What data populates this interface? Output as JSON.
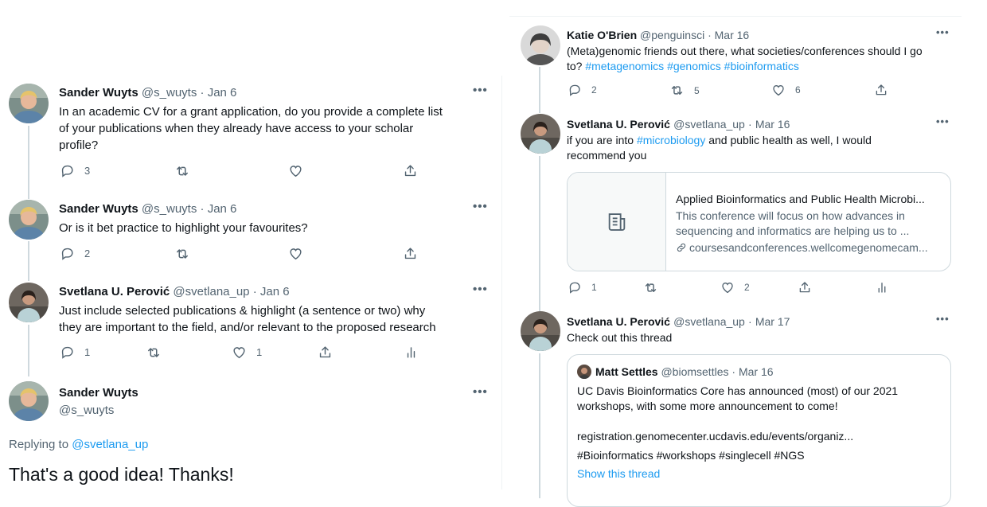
{
  "left": {
    "tweets": [
      {
        "name": "Sander Wuyts",
        "handle": "@s_wuyts",
        "sep": "·",
        "date": "Jan 6",
        "lines": [
          "In an academic CV for a grant application, do you provide a complete list",
          "of your publications when they already have access to your scholar",
          "profile?"
        ],
        "reply_count": "3"
      },
      {
        "name": "Sander Wuyts",
        "handle": "@s_wuyts",
        "sep": "·",
        "date": "Jan 6",
        "lines": [
          "Or is it bet practice to highlight your favourites?"
        ],
        "reply_count": "2"
      },
      {
        "name": "Svetlana U. Perović",
        "handle": "@svetlana_up",
        "sep": "·",
        "date": "Jan 6",
        "lines": [
          "Just include selected publications & highlight (a sentence or two) why",
          "they are important to the field, and/or relevant to the proposed research"
        ],
        "reply_count": "1",
        "like_count": "1"
      }
    ],
    "focused": {
      "name": "Sander Wuyts",
      "handle": "@s_wuyts",
      "replying_prefix": "Replying to",
      "replying_to": "@svetlana_up",
      "text": "That's a good idea! Thanks!"
    }
  },
  "right": {
    "tweet1": {
      "name": "Katie O'Brien",
      "handle": "@penguinsci",
      "sep": "·",
      "date": "Mar 16",
      "line1": "(Meta)genomic friends out there, what societies/conferences should I go",
      "line2_prefix": "to?",
      "hashtags": [
        "#metagenomics",
        "#genomics",
        "#bioinformatics"
      ],
      "reply_count": "2",
      "retweet_count": "5",
      "like_count": "6"
    },
    "tweet2": {
      "name": "Svetlana U. Perović",
      "handle": "@svetlana_up",
      "sep": "·",
      "date": "Mar 16",
      "line1_prefix": "if you are into",
      "line1_link": "#microbiology",
      "line1_suffix": "and public health as well, I would",
      "line2": "recommend you",
      "card": {
        "title": "Applied Bioinformatics and Public Health Microbi...",
        "desc1": "This conference will focus on how advances in",
        "desc2": "sequencing and informatics are helping us to ...",
        "url": "coursesandconferences.wellcomegenomecam..."
      },
      "reply_count": "1",
      "like_count": "2"
    },
    "tweet3": {
      "name": "Svetlana U. Perović",
      "handle": "@svetlana_up",
      "sep": "·",
      "date": "Mar 17",
      "text": "Check out this thread",
      "quote": {
        "name": "Matt Settles",
        "handle": "@biomsettles",
        "sep": "·",
        "date": "Mar 16",
        "line1": "UC Davis Bioinformatics Core has announced (most) of our 2021",
        "line2": "workshops, with some more announcement to come!",
        "url": "registration.genomecenter.ucdavis.edu/events/organiz...",
        "tags": "#Bioinformatics #workshops #singlecell #NGS",
        "show_thread": "Show this thread"
      }
    }
  },
  "icons": {
    "more": "more-icon",
    "reply": "reply-icon",
    "retweet": "retweet-icon",
    "like": "like-icon",
    "share": "share-icon",
    "analytics": "analytics-icon",
    "link": "link-icon",
    "article": "article-icon"
  },
  "colors": {
    "link": "#1d9bf0",
    "text": "#0f1419",
    "secondary": "#536471",
    "border": "#cfd9de"
  }
}
